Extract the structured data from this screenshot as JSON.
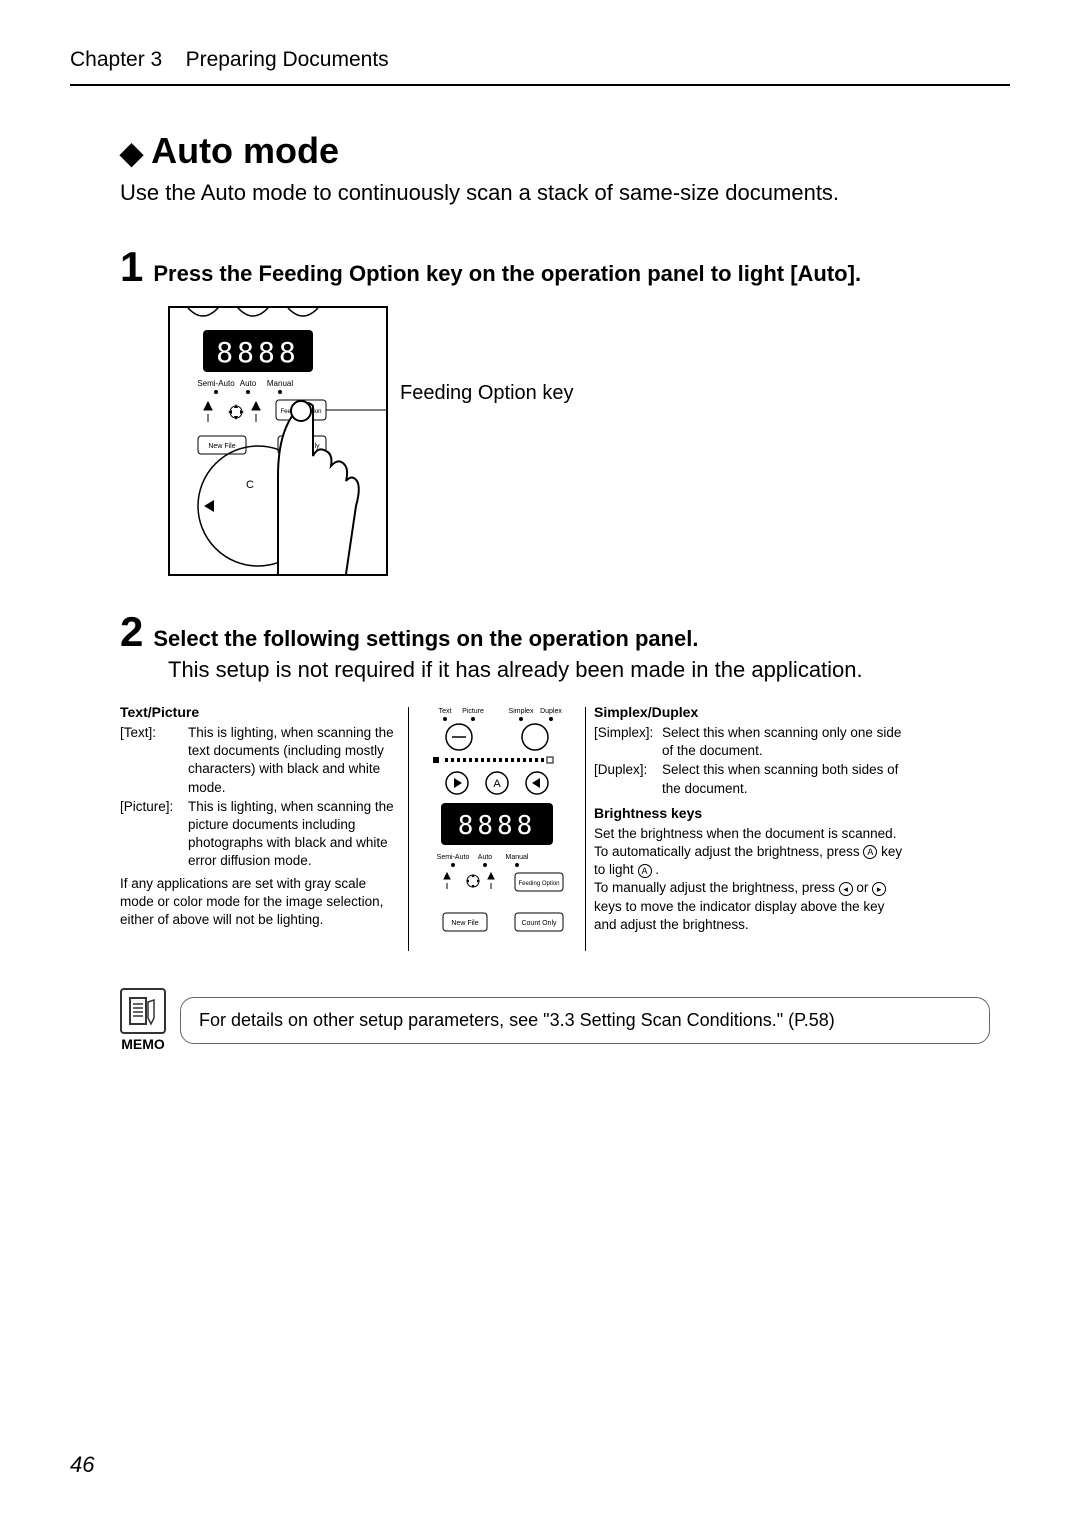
{
  "header": {
    "chapter": "Chapter 3",
    "title": "Preparing Documents"
  },
  "section": {
    "title": "Auto mode",
    "intro": "Use the Auto mode to continuously scan a stack of same-size documents."
  },
  "steps": [
    {
      "num": "1",
      "title": "Press the Feeding Option key on the operation panel to light [Auto].",
      "callout": "Feeding Option key"
    },
    {
      "num": "2",
      "title": "Select the following settings on the operation panel.",
      "body": "This setup is not required if it has already been made in the application."
    }
  ],
  "panel_labels": {
    "semi_auto": "Semi-Auto",
    "auto": "Auto",
    "manual": "Manual",
    "new_file": "New File",
    "count_only": "Count Only",
    "feeding_option": "Feeding Option",
    "text": "Text",
    "picture": "Picture",
    "simplex": "Simplex",
    "duplex": "Duplex",
    "c_key": "C"
  },
  "settings": {
    "text_picture": {
      "title": "Text/Picture",
      "items": [
        {
          "key": "[Text]:",
          "val": "This is lighting, when scanning the text documents (including mostly characters) with black and white mode."
        },
        {
          "key": "[Picture]:",
          "val": "This is lighting, when scanning the picture documents including photographs with black and white error diffusion mode."
        }
      ],
      "note": "If any applications are set with gray scale mode or color mode for the image selection, either of above will not be lighting."
    },
    "simplex_duplex": {
      "title": "Simplex/Duplex",
      "items": [
        {
          "key": "[Simplex]:",
          "val": "Select this when scanning only one side of the document."
        },
        {
          "key": "[Duplex]:",
          "val": "Select this when scanning both sides of the document."
        }
      ]
    },
    "brightness": {
      "title": "Brightness keys",
      "line1": "Set the brightness when the document is scanned.",
      "line2a": "To automatically adjust the brightness, press ",
      "line2b": " key to light ",
      "line2c": " .",
      "line3a": "To manually adjust the brightness, press ",
      "line3b": " or ",
      "line3c": " keys to move the indicator display above the key and adjust the brightness."
    }
  },
  "memo": {
    "label": "MEMO",
    "text": "For details on other setup parameters, see \"3.3 Setting Scan Conditions.\" (P.58)"
  },
  "page_number": "46"
}
